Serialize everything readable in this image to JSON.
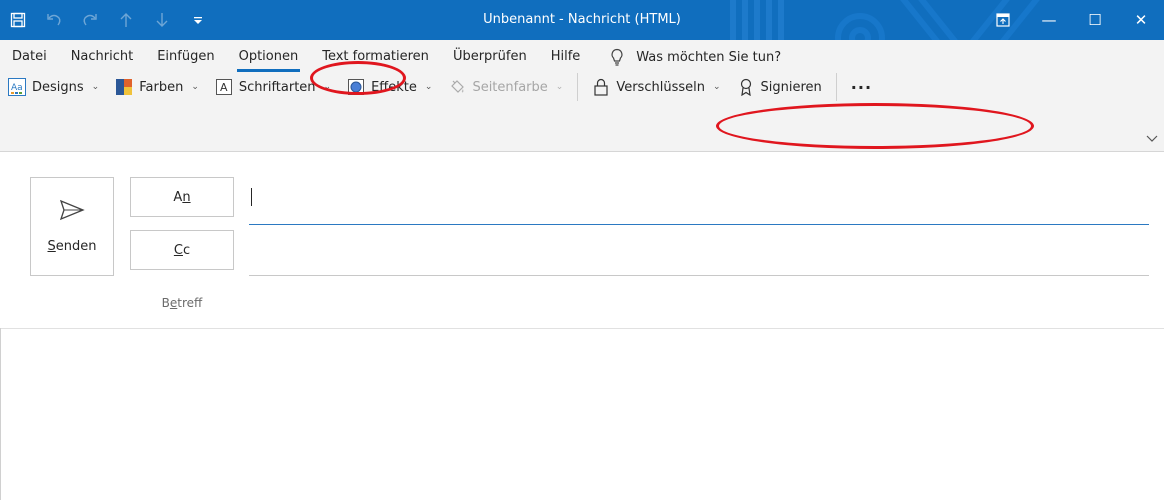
{
  "window": {
    "title": "Unbenannt  -  Nachricht (HTML)",
    "minimize_glyph": "—",
    "maximize_glyph": "☐",
    "close_glyph": "✕"
  },
  "quick_access": {
    "save_icon": "save-icon",
    "undo_icon": "undo-icon",
    "redo_icon": "redo-icon",
    "up_icon": "arrow-up-icon",
    "down_icon": "arrow-down-icon",
    "customize_icon": "customize-qat-icon"
  },
  "ribbon": {
    "tabs": [
      {
        "label": "Datei"
      },
      {
        "label": "Nachricht"
      },
      {
        "label": "Einfügen"
      },
      {
        "label": "Optionen"
      },
      {
        "label": "Text formatieren"
      },
      {
        "label": "Überprüfen"
      },
      {
        "label": "Hilfe"
      }
    ],
    "tell_me": "Was möchten Sie tun?",
    "tools": {
      "designs": "Designs",
      "farben": "Farben",
      "schriftarten": "Schriftarten",
      "effekte": "Effekte",
      "seitenfarbe": "Seitenfarbe",
      "verschluesseln": "Verschlüsseln",
      "signieren": "Signieren",
      "more": "···"
    }
  },
  "compose": {
    "send_underlined": "S",
    "send_rest": "enden",
    "to_pre": "A",
    "to_underlined": "n",
    "cc_underlined": "C",
    "cc_rest": "c",
    "subject_pre": "B",
    "subject_underlined": "e",
    "subject_rest": "treff",
    "to_value": "",
    "cc_value": "",
    "subject_value": ""
  },
  "colors": {
    "titlebar": "#106ebe",
    "highlight": "#e0161e",
    "accent": "#2b79c2"
  }
}
